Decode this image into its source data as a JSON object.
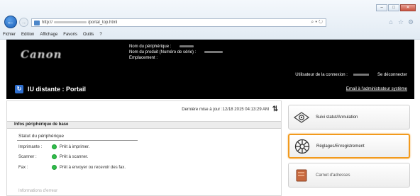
{
  "browser": {
    "url_prefix": "http://",
    "url_suffix": "/portal_top.html",
    "address_tools": "⌕ ▾ ↻",
    "menu": [
      "Fichier",
      "Edition",
      "Affichage",
      "Favoris",
      "Outils",
      "?"
    ],
    "window_buttons": [
      "–",
      "□",
      "✕"
    ],
    "toolbar_icons": [
      "⌂",
      "☆",
      "⚙"
    ]
  },
  "header": {
    "logo": "Canon",
    "device_name_label": "Nom du périphérique :",
    "product_name_label": "Nom du produit (Numéro de série) :",
    "location_label": "Emplacement :",
    "login_user_label": "Utilisateur de la connexion :",
    "logout_link": "Se déconnecter",
    "title": "IU distante : Portail",
    "mail_admin_link": "Email à l'administrateur système"
  },
  "main": {
    "last_update": "Dernière mise à jour :12/18 2015 04:13:29 AM",
    "section_title": "Infos périphérique de base",
    "status_title": "Statut du périphérique",
    "rows": [
      {
        "label": "Imprimante :",
        "value": "Prêt à imprimer."
      },
      {
        "label": "Scanner :",
        "value": "Prêt à scanner."
      },
      {
        "label": "Fax :",
        "value": "Prêt à envoyer ou recevoir des fax."
      }
    ],
    "faded_section": "Informations d'erreur"
  },
  "side_buttons": [
    {
      "label": "Suivi statut/Annulation",
      "icon": "status-eye-icon"
    },
    {
      "label": "Réglages/Enregistrement",
      "icon": "settings-gear-icon",
      "highlight": "#f29a1d"
    },
    {
      "label": "Carnet d'adresses",
      "icon": "address-book-icon"
    }
  ]
}
